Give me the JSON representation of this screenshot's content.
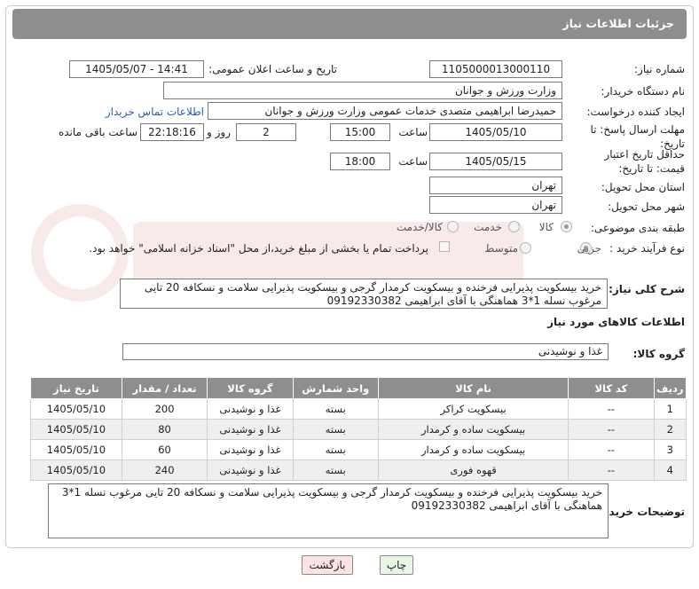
{
  "header": {
    "title": "جزئیات اطلاعات نیاز"
  },
  "fields": {
    "need_number_label": "شماره نیاز:",
    "need_number": "1105000013000110",
    "announce_label": "تاریخ و ساعت اعلان عمومی:",
    "announce_value": "1405/05/07 - 14:41",
    "buyer_org_label": "نام دستگاه خریدار:",
    "buyer_org": "وزارت ورزش و جوانان",
    "creator_label": "ایجاد کننده درخواست:",
    "creator": "حمیدرضا ابراهیمی متصدی خدمات عمومی وزارت ورزش و جوانان",
    "contact_link": "اطلاعات تماس خریدار",
    "deadline_label": "مهلت ارسال پاسخ: تا تاریخ:",
    "deadline_date": "1405/05/10",
    "time_label": "ساعت",
    "deadline_time": "15:00",
    "days_value": "2",
    "days_label": "روز و",
    "remaining_time": "22:18:16",
    "remaining_label": "ساعت باقی مانده",
    "validity_label": "حداقل تاریخ اعتبار قیمت: تا تاریخ:",
    "validity_date": "1405/05/15",
    "validity_time": "18:00",
    "province_label": "استان محل تحویل:",
    "province": "تهران",
    "city_label": "شهر محل تحویل:",
    "city": "تهران",
    "category_label": "طبقه بندی موضوعی:",
    "category_options": [
      "کالا",
      "خدمت",
      "کالا/خدمت"
    ],
    "purchase_type_label": "نوع فرآیند خرید :",
    "purchase_options": [
      "جزیی",
      "متوسط"
    ],
    "payment_note": "پرداخت تمام یا بخشی از مبلغ خرید،از محل \"اسناد خزانه اسلامی\" خواهد بود.",
    "summary_label": "شرح کلی نیاز:",
    "summary": "خرید بیسکویت پذیرایی فرخنده و بیسکویت کرمدار گرجی و بیسکویت پذیرایی سلامت و نسکافه 20 تایی مرغوب نسله 1*3 هماهنگی با آقای ابراهیمی 09192330382",
    "goods_info_title": "اطلاعات کالاهای مورد نیاز",
    "goods_group_label": "گروه کالا:",
    "goods_group": "غذا و نوشیدنی",
    "buyer_notes_label": "توضیحات خریدار:",
    "buyer_notes": "خرید بیسکویت پذیرایی فرخنده و بیسکویت کرمدار گرجی و بیسکویت پذیرایی سلامت و نسکافه 20 تایی مرغوب نسله 1*3 هماهنگی با آقای ابراهیمی 09192330382"
  },
  "table": {
    "headers": [
      "ردیف",
      "کد کالا",
      "نام کالا",
      "واحد شمارش",
      "گروه کالا",
      "تعداد / مقدار",
      "تاریخ نیاز"
    ],
    "rows": [
      [
        "1",
        "--",
        "بیسکویت کراکر",
        "بسته",
        "غذا و نوشیدنی",
        "200",
        "1405/05/10"
      ],
      [
        "2",
        "--",
        "بیسکویت ساده و کرمدار",
        "بسته",
        "غذا و نوشیدنی",
        "80",
        "1405/05/10"
      ],
      [
        "3",
        "--",
        "بیسکویت ساده و کرمدار",
        "بسته",
        "غذا و نوشیدنی",
        "60",
        "1405/05/10"
      ],
      [
        "4",
        "--",
        "قهوه فوری",
        "بسته",
        "غذا و نوشیدنی",
        "240",
        "1405/05/10"
      ]
    ]
  },
  "buttons": {
    "print": "چاپ",
    "back": "بازگشت"
  },
  "colors": {
    "header_bg": "#8e8e8e",
    "link": "#2a5db0",
    "back_btn_bg": "#fbe3e3",
    "print_btn_bg": "#e8f6e4"
  }
}
